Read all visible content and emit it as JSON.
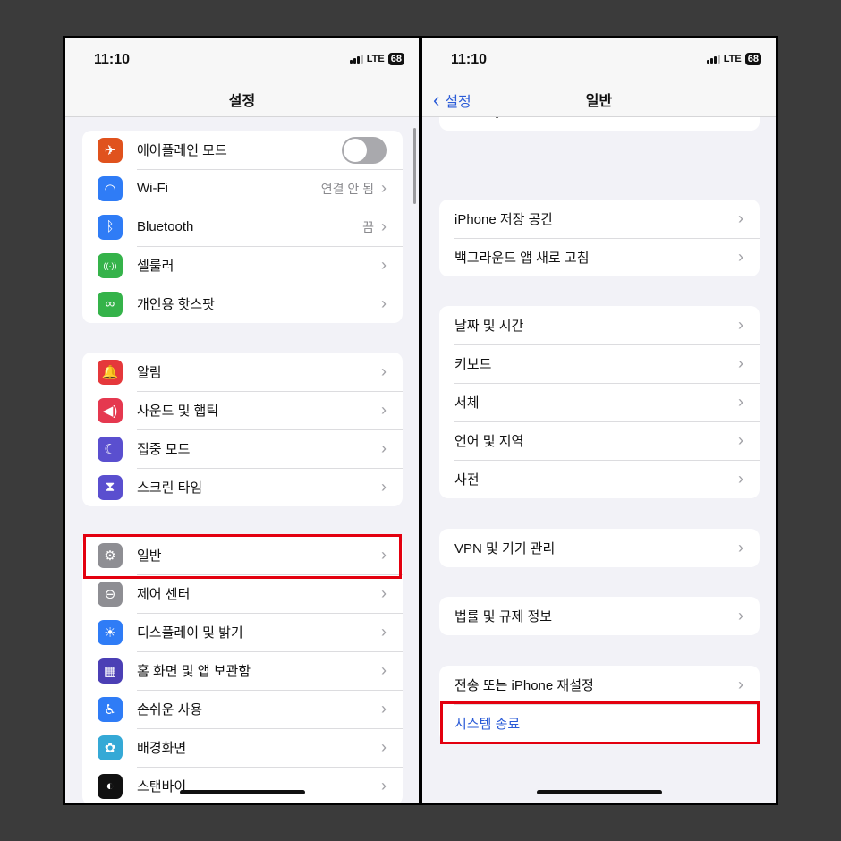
{
  "status": {
    "time": "11:10",
    "network": "LTE",
    "battery": "68"
  },
  "left": {
    "title": "설정",
    "groups": [
      [
        {
          "label": "에어플레인 모드",
          "icon": "airplane-icon",
          "color": "#e0521d",
          "toggle": false
        },
        {
          "label": "Wi-Fi",
          "icon": "wifi-icon",
          "color": "#2f7cf6",
          "value": "연결 안 됨"
        },
        {
          "label": "Bluetooth",
          "icon": "bluetooth-icon",
          "color": "#2f7cf6",
          "value": "끔"
        },
        {
          "label": "셀룰러",
          "icon": "cellular-icon",
          "color": "#35b34a"
        },
        {
          "label": "개인용 핫스팟",
          "icon": "hotspot-icon",
          "color": "#35b34a"
        }
      ],
      [
        {
          "label": "알림",
          "icon": "bell-icon",
          "color": "#e5383b"
        },
        {
          "label": "사운드 및 햅틱",
          "icon": "speaker-icon",
          "color": "#e5384f"
        },
        {
          "label": "집중 모드",
          "icon": "moon-icon",
          "color": "#5a4fcf"
        },
        {
          "label": "스크린 타임",
          "icon": "hourglass-icon",
          "color": "#5a4fcf"
        }
      ],
      [
        {
          "label": "일반",
          "icon": "gear-icon",
          "color": "#8e8e93"
        },
        {
          "label": "제어 센터",
          "icon": "switches-icon",
          "color": "#8e8e93"
        },
        {
          "label": "디스플레이 및 밝기",
          "icon": "sun-icon",
          "color": "#2f7cf6"
        },
        {
          "label": "홈 화면 및 앱 보관함",
          "icon": "grid-icon",
          "color": "#4b3fb5"
        },
        {
          "label": "손쉬운 사용",
          "icon": "accessibility-icon",
          "color": "#2f7cf6"
        },
        {
          "label": "배경화면",
          "icon": "flower-icon",
          "color": "#35a9d6"
        },
        {
          "label": "스탠바이",
          "icon": "standby-icon",
          "color": "#111111"
        }
      ]
    ]
  },
  "right": {
    "title": "일반",
    "back": "설정",
    "groups": [
      [
        "CarPlay"
      ],
      [
        "iPhone 저장 공간",
        "백그라운드 앱 새로 고침"
      ],
      [
        "날짜 및 시간",
        "키보드",
        "서체",
        "언어 및 지역",
        "사전"
      ],
      [
        "VPN 및 기기 관리"
      ],
      [
        "법률 및 규제 정보"
      ],
      [
        "전송 또는 iPhone 재설정",
        "시스템 종료"
      ]
    ]
  },
  "accent": "#2a5bd7",
  "highlight": "#e3000f"
}
